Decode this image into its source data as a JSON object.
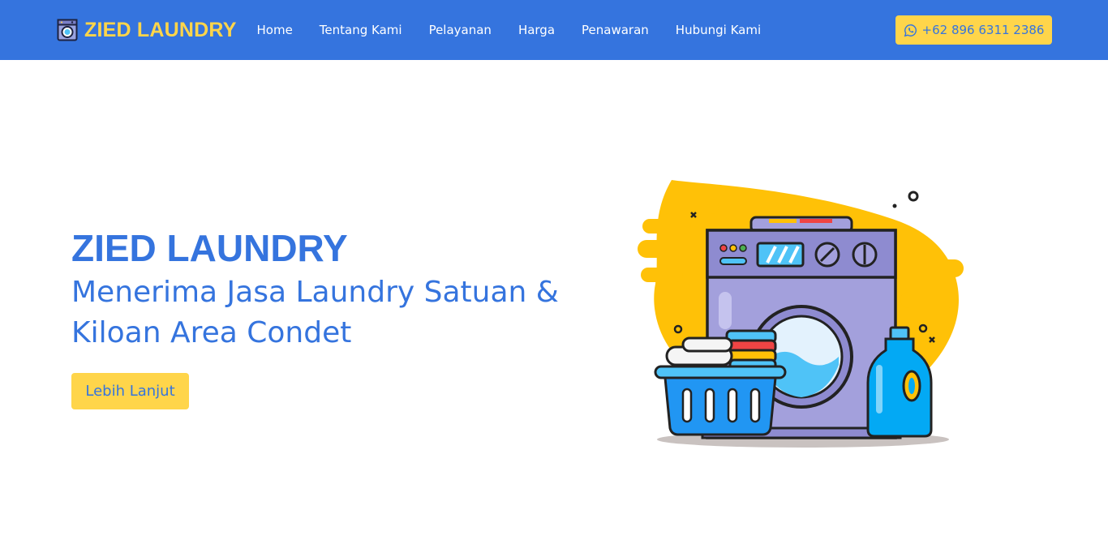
{
  "navbar": {
    "brand": "ZIED LAUNDRY",
    "links": [
      "Home",
      "Tentang Kami",
      "Pelayanan",
      "Harga",
      "Penawaran",
      "Hubungi Kami"
    ],
    "phone": "+62 896 6311 2386"
  },
  "hero": {
    "title": "ZIED LAUNDRY",
    "subtitle": "Menerima Jasa Laundry Satuan & Kiloan Area Condet",
    "button": "Lebih Lanjut"
  },
  "colors": {
    "primary": "#3574de",
    "accent": "#ffd54a",
    "illustration_splash": "#ffc107",
    "machine_body": "#a3a0dc",
    "basket": "#2196f3",
    "bottle": "#03a9f4"
  },
  "icons": [
    "washing-machine-icon",
    "whatsapp-icon"
  ]
}
